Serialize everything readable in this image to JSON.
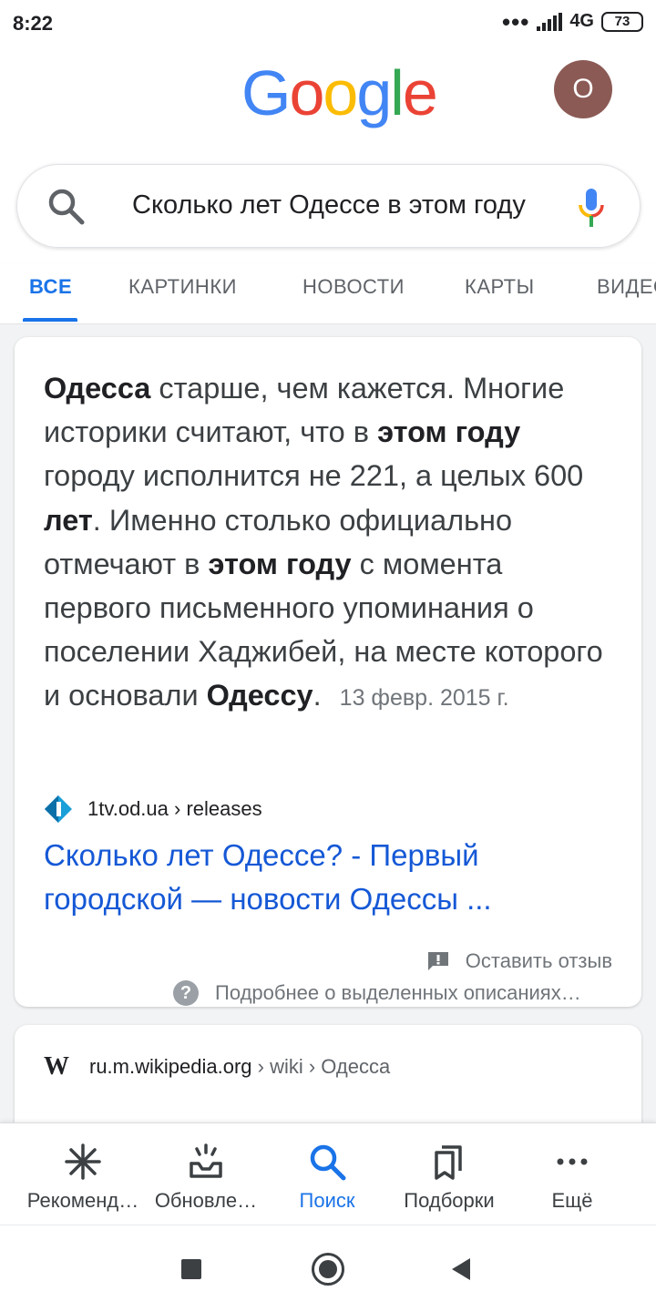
{
  "status_bar": {
    "time": "8:22",
    "network": "4G",
    "battery": "73"
  },
  "header": {
    "logo": [
      "G",
      "o",
      "o",
      "g",
      "l",
      "e"
    ],
    "logo_colors": [
      "#4285f4",
      "#ea4335",
      "#fbbc05",
      "#4285f4",
      "#34a853",
      "#ea4335"
    ],
    "avatar_letter": "O",
    "avatar_color": "#8b5a55"
  },
  "search": {
    "query": "Сколько лет Одессе в этом году"
  },
  "tabs": [
    {
      "label": "ВСЕ",
      "active": true
    },
    {
      "label": "КАРТИНКИ"
    },
    {
      "label": "НОВОСТИ"
    },
    {
      "label": "КАРТЫ"
    },
    {
      "label": "ВИДЕО"
    }
  ],
  "featured": {
    "snippet": {
      "p1": "Одесса",
      "p2": " старше, чем кажется. Многие историки считают, что в ",
      "p3": "этом году",
      "p4": " городу исполнится не 221, а целых 600 ",
      "p5": "лет",
      "p6": ". Именно столько официально отмечают в ",
      "p7": "этом году",
      "p8": " с момента первого письменного упоминания о поселении Хаджибей, на месте которого и основали ",
      "p9": "Одессу",
      "p10": "."
    },
    "date": "13 февр. 2015 г.",
    "source_domain": "1tv.od.ua",
    "source_path": " › releases",
    "link_title": "Сколько лет Одессе? - Первый городской — новости Одессы ...",
    "feedback_label": "Оставить отзыв",
    "more_about_label": "Подробнее о выделенных описаниях…"
  },
  "wiki_result": {
    "domain": "ru.m.wikipedia.org",
    "path": " › wiki › Одесса"
  },
  "bottom_nav": [
    {
      "label": "Рекоменд…",
      "icon": "asterisk-icon"
    },
    {
      "label": "Обновле…",
      "icon": "updates-icon"
    },
    {
      "label": "Поиск",
      "icon": "search-icon",
      "active": true
    },
    {
      "label": "Подборки",
      "icon": "collections-icon"
    },
    {
      "label": "Ещё",
      "icon": "more-icon"
    }
  ],
  "colors": {
    "accent": "#1a73e8",
    "link": "#1558d6"
  }
}
